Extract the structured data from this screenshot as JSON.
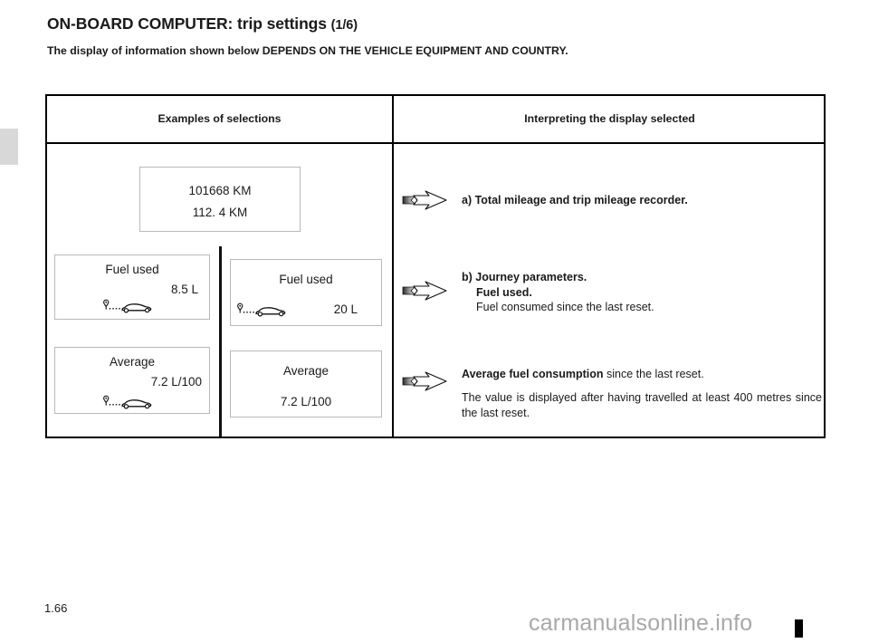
{
  "header": {
    "title": "ON-BOARD COMPUTER: trip settings",
    "page_indicator": "(1/6)",
    "subtitle": "The display of information shown below DEPENDS ON THE VEHICLE EQUIPMENT AND COUNTRY."
  },
  "table": {
    "columns": [
      {
        "header": "Examples of selections"
      },
      {
        "header": "Interpreting the display selected"
      }
    ],
    "displays": {
      "mileage": {
        "line1": "101668 KM",
        "line2": "112. 4 KM"
      },
      "fuel_used_1": {
        "title": "Fuel used",
        "value": "8.5 L",
        "icon": "car-trip-icon"
      },
      "fuel_used_2": {
        "title": "Fuel used",
        "value": "20 L",
        "icon": "car-trip-icon"
      },
      "average_1": {
        "title": "Average",
        "value": "7.2 L/100",
        "icon": "car-trip-icon"
      },
      "average_2": {
        "title": "Average",
        "value": "7.2 L/100"
      }
    },
    "explanations": {
      "a": {
        "arrow": "arrow-right-icon",
        "text": "a) Total mileage and trip mileage recorder."
      },
      "b": {
        "arrow": "arrow-right-icon",
        "line1": "b) Journey parameters.",
        "line2": "Fuel used.",
        "line3": "Fuel consumed since the last reset."
      },
      "c": {
        "arrow": "arrow-right-icon",
        "lead_bold": "Average fuel consumption",
        "lead_rest": " since the last reset.",
        "body": "The value is displayed after having travelled at least 400 metres since the last reset."
      }
    }
  },
  "footer": {
    "folio": "1.66",
    "watermark": "carmanualsonline.info"
  },
  "colors": {
    "page_background": "#ffffff",
    "text": "#1a1a1a",
    "table_border": "#000000",
    "lcd_border": "#b9b9b9",
    "side_tab": "#d8d8d8",
    "watermark": "#a8a8a8"
  }
}
